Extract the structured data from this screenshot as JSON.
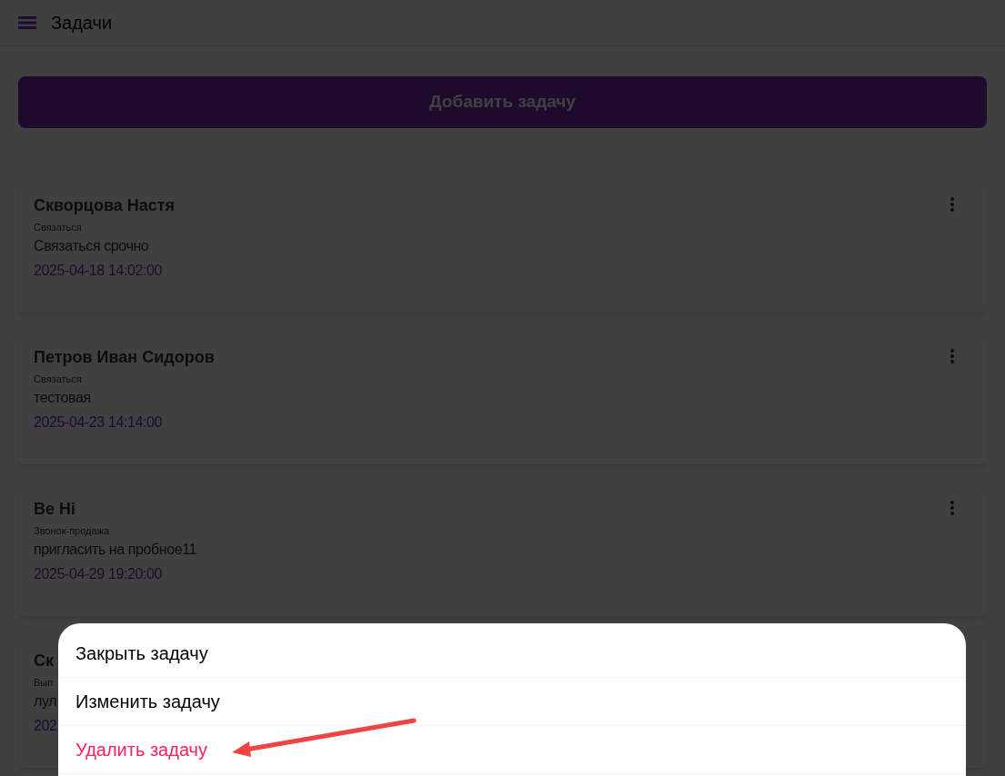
{
  "header": {
    "title": "Задачи"
  },
  "add_button": "Добавить задачу",
  "tasks": [
    {
      "name": "Скворцова Настя",
      "type": "Связаться",
      "note": "Связаться срочно",
      "date": "2025-04-18 14:02:00"
    },
    {
      "name": "Петров Иван Сидоров",
      "type": "Связаться",
      "note": "тестовая",
      "date": "2025-04-23 14:14:00"
    },
    {
      "name": "Be Hi",
      "type": "Звонок-продажа",
      "note": "пригласить на пробное11",
      "date": "2025-04-29 19:20:00"
    },
    {
      "name": "Ск",
      "type": "Вып",
      "note": "лул",
      "date": "202"
    }
  ],
  "menu": {
    "items": [
      {
        "label": "Закрыть задачу",
        "kind": "normal"
      },
      {
        "label": "Изменить задачу",
        "kind": "normal"
      },
      {
        "label": "Удалить задачу",
        "kind": "danger"
      }
    ]
  }
}
